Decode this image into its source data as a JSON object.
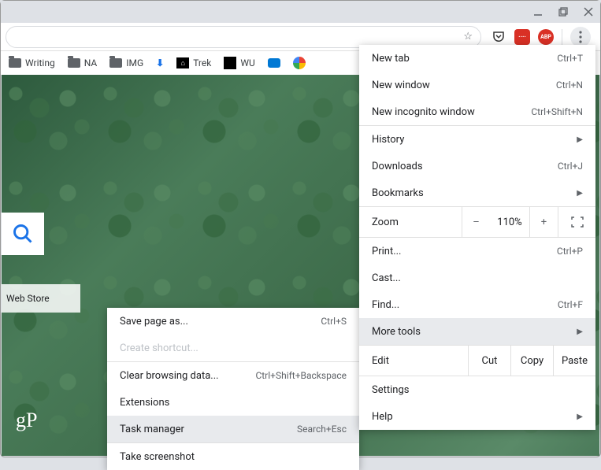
{
  "window_controls": {
    "min": "minimize",
    "max": "maximize",
    "close": "close"
  },
  "bookmarks": {
    "items": [
      {
        "label": "Writing",
        "icon": "folder"
      },
      {
        "label": "NA",
        "icon": "folder"
      },
      {
        "label": "IMG",
        "icon": "folder"
      },
      {
        "label": "",
        "icon": "download"
      },
      {
        "label": "Trek",
        "icon": "trek"
      },
      {
        "label": "WU",
        "icon": "wu"
      },
      {
        "label": "",
        "icon": "onedrive"
      },
      {
        "label": "",
        "icon": "gphotos"
      }
    ]
  },
  "extensions": {
    "pocket": "pocket",
    "lastpass": "····",
    "abp": "ABP"
  },
  "tiles": {
    "webstore_label": "Web Store",
    "gp_logo": "gP"
  },
  "menu": {
    "new_tab": {
      "label": "New tab",
      "shortcut": "Ctrl+T"
    },
    "new_window": {
      "label": "New window",
      "shortcut": "Ctrl+N"
    },
    "new_incognito": {
      "label": "New incognito window",
      "shortcut": "Ctrl+Shift+N"
    },
    "history": {
      "label": "History"
    },
    "downloads": {
      "label": "Downloads",
      "shortcut": "Ctrl+J"
    },
    "bookmarks": {
      "label": "Bookmarks"
    },
    "zoom": {
      "label": "Zoom",
      "minus": "–",
      "value": "110%",
      "plus": "+"
    },
    "print": {
      "label": "Print...",
      "shortcut": "Ctrl+P"
    },
    "cast": {
      "label": "Cast..."
    },
    "find": {
      "label": "Find...",
      "shortcut": "Ctrl+F"
    },
    "more_tools": {
      "label": "More tools"
    },
    "edit": {
      "label": "Edit",
      "cut": "Cut",
      "copy": "Copy",
      "paste": "Paste"
    },
    "settings": {
      "label": "Settings"
    },
    "help": {
      "label": "Help"
    }
  },
  "submenu": {
    "save_page": {
      "label": "Save page as...",
      "shortcut": "Ctrl+S"
    },
    "create_shortcut": {
      "label": "Create shortcut..."
    },
    "clear_data": {
      "label": "Clear browsing data...",
      "shortcut": "Ctrl+Shift+Backspace"
    },
    "extensions": {
      "label": "Extensions"
    },
    "task_manager": {
      "label": "Task manager",
      "shortcut": "Search+Esc"
    },
    "screenshot": {
      "label": "Take screenshot"
    }
  }
}
